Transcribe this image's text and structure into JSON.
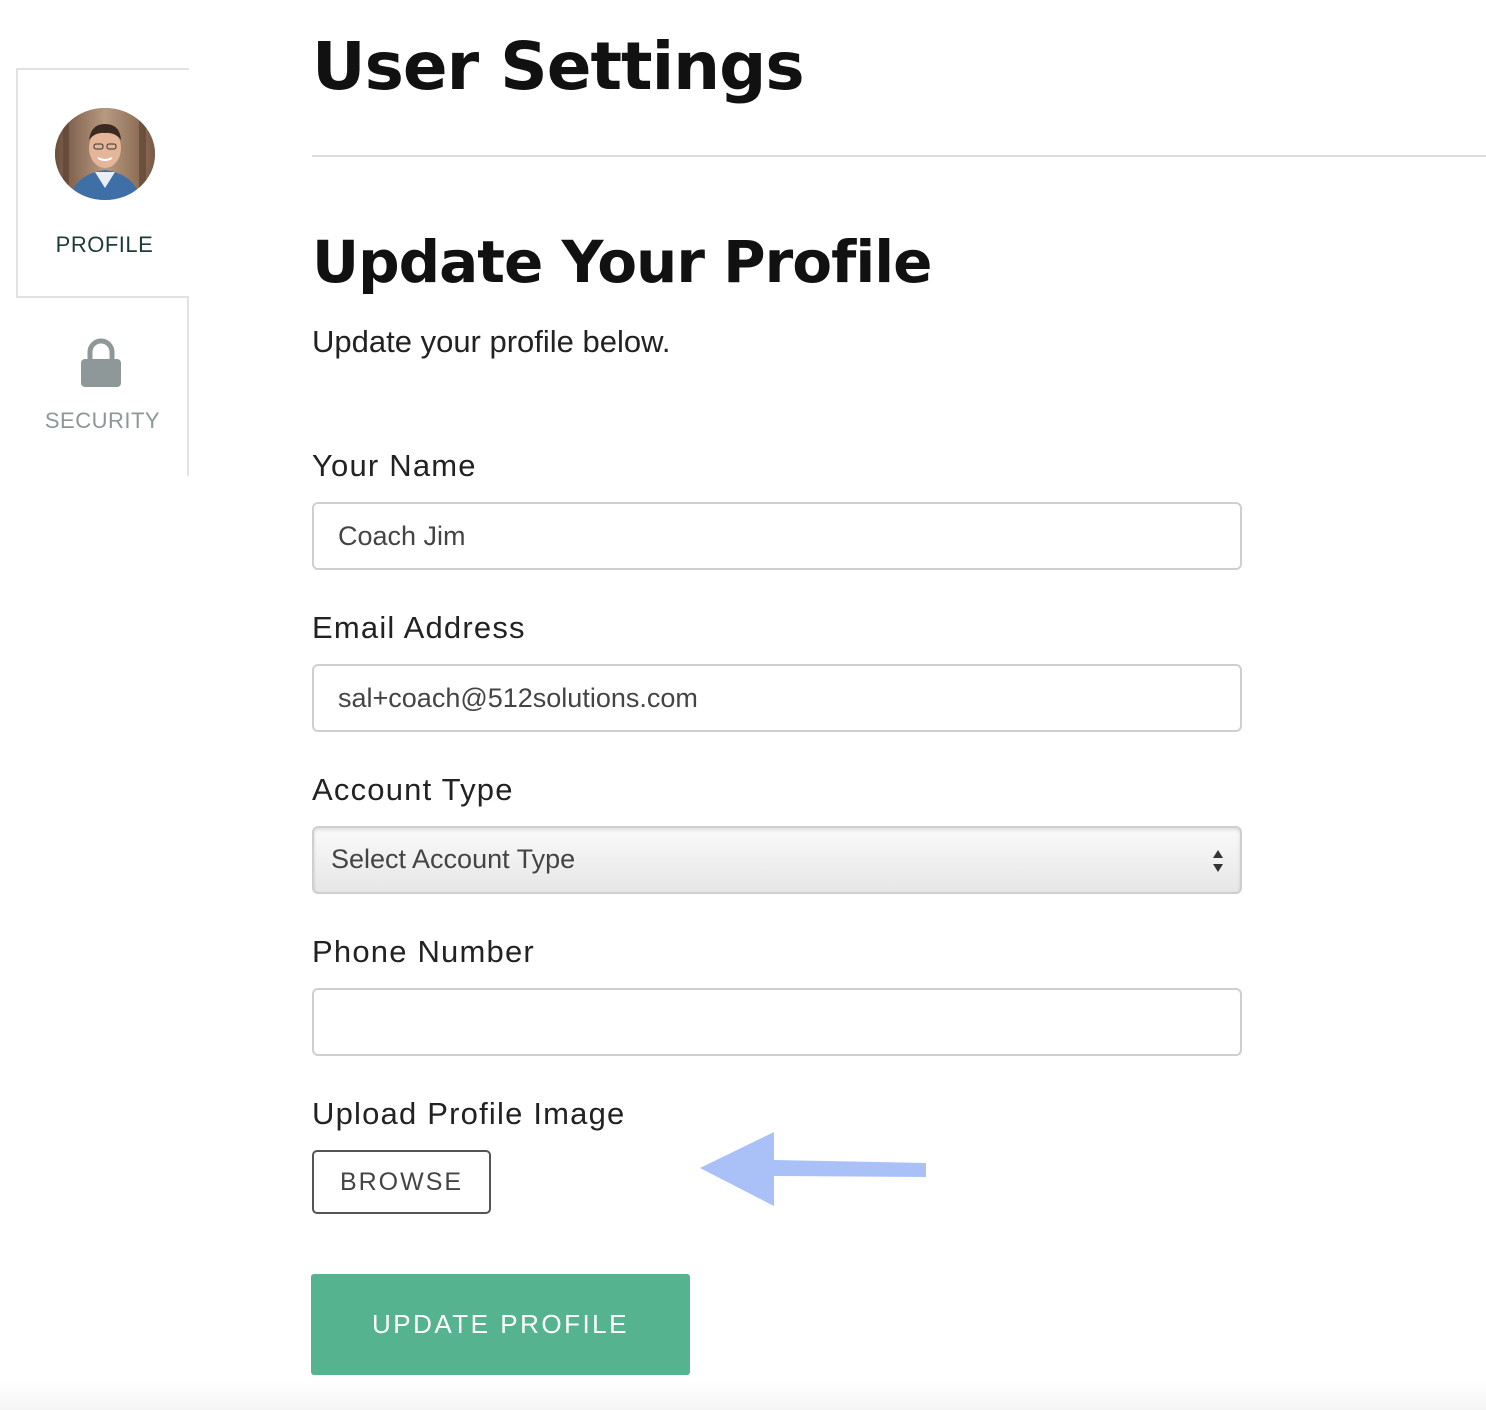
{
  "sidebar": {
    "tabs": [
      {
        "label": "PROFILE",
        "icon": "avatar",
        "active": true
      },
      {
        "label": "SECURITY",
        "icon": "lock-icon",
        "active": false
      }
    ]
  },
  "header": {
    "title": "User Settings"
  },
  "section": {
    "title": "Update Your Profile",
    "subtitle": "Update your profile below."
  },
  "form": {
    "name": {
      "label": "Your Name",
      "value": "Coach Jim"
    },
    "email": {
      "label": "Email Address",
      "value": "sal+coach@512solutions.com"
    },
    "account_type": {
      "label": "Account Type",
      "selected": "Select Account Type"
    },
    "phone": {
      "label": "Phone Number",
      "value": ""
    },
    "upload": {
      "label": "Upload Profile Image",
      "button_label": "BROWSE"
    },
    "submit_label": "UPDATE PROFILE"
  },
  "colors": {
    "accent_green": "#55b48f",
    "annotation_arrow": "#a9c1f7",
    "sidebar_active_text": "#1e3b39",
    "sidebar_inactive_text": "#8c9797"
  }
}
